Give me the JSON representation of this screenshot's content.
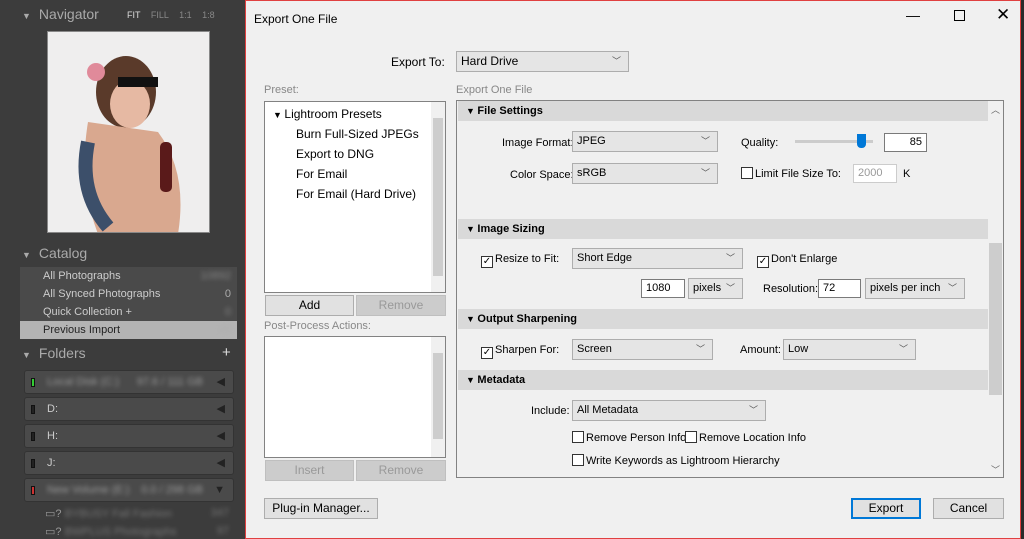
{
  "lightroom": {
    "navigator": {
      "title": "Navigator",
      "zoom_options": [
        "FIT",
        "FILL",
        "1:1",
        "1:8"
      ]
    },
    "catalog": {
      "title": "Catalog",
      "items": [
        {
          "label": "All Photographs",
          "count": "10892"
        },
        {
          "label": "All Synced Photographs",
          "count": "0"
        },
        {
          "label": "Quick Collection +",
          "count": "0"
        },
        {
          "label": "Previous Import",
          "count": "46"
        }
      ]
    },
    "folders": {
      "title": "Folders",
      "add_icon": "plus-icon",
      "drives": [
        {
          "label": "Local Disk (C:)",
          "info": "97.6 / 111 GB",
          "led": "#3c3"
        },
        {
          "label": "D:",
          "info": "",
          "led": "#222"
        },
        {
          "label": "H:",
          "info": "",
          "led": "#222"
        },
        {
          "label": "J:",
          "info": "",
          "led": "#222"
        },
        {
          "label": "New Volume (E:)",
          "info": "0.0 / 298 GB",
          "led": "#c33"
        }
      ],
      "subfolders": [
        {
          "label": "BYBUSY Fall Fashion",
          "count": "347"
        },
        {
          "label": "BWPLUS Photographs",
          "count": "97"
        }
      ]
    }
  },
  "dialog": {
    "title": "Export One File",
    "export_to_label": "Export To:",
    "export_to_value": "Hard Drive",
    "preset_label": "Preset:",
    "presets_root": "Lightroom Presets",
    "presets": [
      "Burn Full-Sized JPEGs",
      "Export to DNG",
      "For Email",
      "For Email (Hard Drive)"
    ],
    "add": "Add",
    "remove": "Remove",
    "post_process_label": "Post-Process Actions:",
    "insert": "Insert",
    "remove2": "Remove",
    "panel_label": "Export One File",
    "file_settings": {
      "title": "File Settings",
      "image_format_label": "Image Format:",
      "image_format": "JPEG",
      "quality_label": "Quality:",
      "quality": "85",
      "quality_fraction": 0.85,
      "color_space_label": "Color Space:",
      "color_space": "sRGB",
      "limit_label": "Limit File Size To:",
      "limit_value": "2000",
      "limit_unit": "K",
      "limit_checked": false
    },
    "image_sizing": {
      "title": "Image Sizing",
      "resize_label": "Resize to Fit:",
      "resize_checked": true,
      "resize_mode": "Short Edge",
      "dont_enlarge": "Don't Enlarge",
      "dont_enlarge_checked": true,
      "size_value": "1080",
      "size_unit": "pixels",
      "resolution_label": "Resolution:",
      "resolution": "72",
      "resolution_unit": "pixels per inch"
    },
    "output_sharpening": {
      "title": "Output Sharpening",
      "sharpen_label": "Sharpen For:",
      "sharpen_checked": true,
      "sharpen_for": "Screen",
      "amount_label": "Amount:",
      "amount": "Low"
    },
    "metadata": {
      "title": "Metadata",
      "include_label": "Include:",
      "include": "All Metadata",
      "remove_person": "Remove Person Info",
      "remove_location": "Remove Location Info",
      "write_keywords": "Write Keywords as Lightroom Hierarchy"
    },
    "plugin_manager": "Plug-in Manager...",
    "export": "Export",
    "cancel": "Cancel"
  },
  "colors": {
    "accent": "#0078d7",
    "dialog_border": "#e04040"
  }
}
